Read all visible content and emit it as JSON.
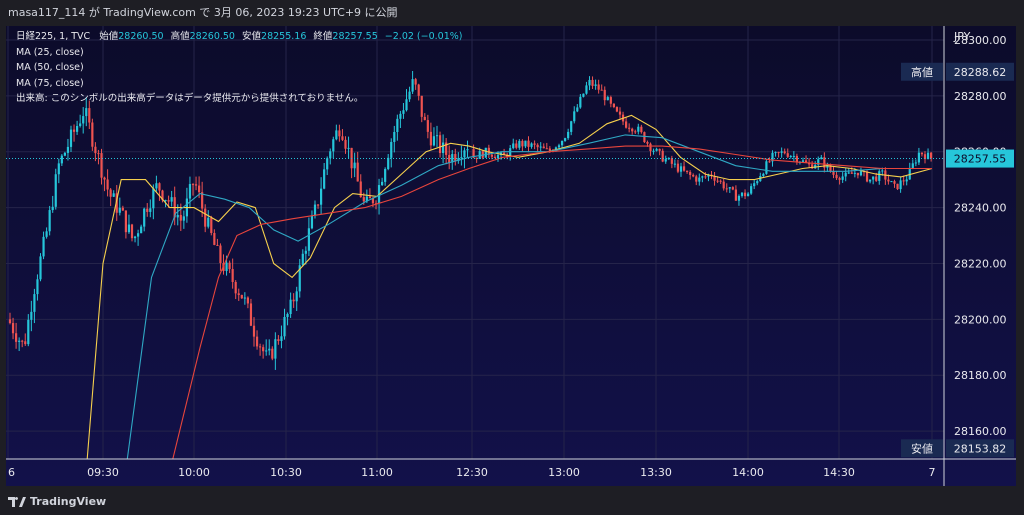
{
  "header": {
    "publish_line": "masa117_114 が TradingView.com で 3月 06, 2023 19:23 UTC+9 に公開"
  },
  "legend": {
    "symbol": "日経225, 1, TVC",
    "open_label": "始値",
    "open_value": "28260.50",
    "high_label": "高値",
    "high_value": "28260.50",
    "low_label": "安値",
    "low_value": "28255.16",
    "close_label": "終値",
    "close_value": "28257.55",
    "change": "−2.02 (−0.01%)",
    "ma25": "MA (25, close)",
    "ma50": "MA (50, close)",
    "ma75": "MA (75, close)",
    "volume_note": "出来高: このシンボルの出来高データはデータ提供元から提供されておりません。"
  },
  "price_axis": {
    "currency": "JPY",
    "high_tag_label": "高値",
    "low_tag_label": "安値"
  },
  "footer": {
    "brand": "TradingView"
  },
  "colors": {
    "background": "#0c0b2a",
    "up": "#26c6da",
    "down": "#ef5350",
    "ma25": "#f6d04d",
    "ma50": "#2fa8c4",
    "ma75": "#e8453c",
    "grid": "#25244a",
    "last_price_tag": "#26c6da"
  },
  "chart_data": {
    "type": "candlestick",
    "interval": "1",
    "session_date": "2023-03-06",
    "ylim": [
      28150,
      28305
    ],
    "yticks": [
      28160,
      28180,
      28200,
      28220,
      28240,
      28260,
      28280,
      28300
    ],
    "x_tick_labels": [
      "6",
      "09:30",
      "10:00",
      "10:30",
      "11:00",
      "12:30",
      "13:00",
      "13:30",
      "14:00",
      "14:30",
      "7"
    ],
    "session_high": 28288.62,
    "session_low": 28153.82,
    "last_price": 28257.55,
    "open": 28260.5,
    "high": 28260.5,
    "low": 28255.16,
    "close": 28257.55,
    "price_path": [
      [
        "09:00",
        28200
      ],
      [
        "09:05",
        28190
      ],
      [
        "09:08",
        28210
      ],
      [
        "09:12",
        28230
      ],
      [
        "09:16",
        28255
      ],
      [
        "09:20",
        28265
      ],
      [
        "09:24",
        28275
      ],
      [
        "09:28",
        28260
      ],
      [
        "09:32",
        28245
      ],
      [
        "09:36",
        28238
      ],
      [
        "09:40",
        28228
      ],
      [
        "09:44",
        28240
      ],
      [
        "09:48",
        28248
      ],
      [
        "09:52",
        28242
      ],
      [
        "09:56",
        28235
      ],
      [
        "10:00",
        28250
      ],
      [
        "10:04",
        28235
      ],
      [
        "10:08",
        28222
      ],
      [
        "10:12",
        28215
      ],
      [
        "10:16",
        28208
      ],
      [
        "10:20",
        28195
      ],
      [
        "10:24",
        28185
      ],
      [
        "10:28",
        28195
      ],
      [
        "10:32",
        28205
      ],
      [
        "10:36",
        28225
      ],
      [
        "10:40",
        28240
      ],
      [
        "10:44",
        28260
      ],
      [
        "10:48",
        28270
      ],
      [
        "10:52",
        28255
      ],
      [
        "10:56",
        28240
      ],
      [
        "11:00",
        28245
      ],
      [
        "11:04",
        28262
      ],
      [
        "11:08",
        28275
      ],
      [
        "11:12",
        28285
      ],
      [
        "11:16",
        28268
      ],
      [
        "11:20",
        28262
      ],
      [
        "11:24",
        28258
      ],
      [
        "11:28",
        28262
      ],
      [
        "11:30",
        28263
      ],
      [
        "12:30",
        28258
      ],
      [
        "12:35",
        28260
      ],
      [
        "12:40",
        28258
      ],
      [
        "12:45",
        28263
      ],
      [
        "12:50",
        28262
      ],
      [
        "12:55",
        28260
      ],
      [
        "13:00",
        28265
      ],
      [
        "13:04",
        28275
      ],
      [
        "13:08",
        28285
      ],
      [
        "13:12",
        28282
      ],
      [
        "13:16",
        28275
      ],
      [
        "13:20",
        28270
      ],
      [
        "13:24",
        28268
      ],
      [
        "13:28",
        28262
      ],
      [
        "13:32",
        28258
      ],
      [
        "13:36",
        28255
      ],
      [
        "13:40",
        28252
      ],
      [
        "13:44",
        28250
      ],
      [
        "13:48",
        28252
      ],
      [
        "13:52",
        28248
      ],
      [
        "13:56",
        28244
      ],
      [
        "14:00",
        28245
      ],
      [
        "14:04",
        28252
      ],
      [
        "14:08",
        28258
      ],
      [
        "14:12",
        28260
      ],
      [
        "14:16",
        28258
      ],
      [
        "14:20",
        28255
      ],
      [
        "14:24",
        28257
      ],
      [
        "14:28",
        28252
      ],
      [
        "14:32",
        28251
      ],
      [
        "14:36",
        28253
      ],
      [
        "14:40",
        28250
      ],
      [
        "14:44",
        28252
      ],
      [
        "14:48",
        28247
      ],
      [
        "14:52",
        28251
      ],
      [
        "14:56",
        28260
      ],
      [
        "15:00",
        28257.55
      ]
    ],
    "ma_series": [
      {
        "name": "MA (25, close)",
        "color": "#f6d04d",
        "values": [
          [
            "09:25",
            28150
          ],
          [
            "09:30",
            28220
          ],
          [
            "09:36",
            28250
          ],
          [
            "09:44",
            28250
          ],
          [
            "09:52",
            28240
          ],
          [
            "10:00",
            28240
          ],
          [
            "10:08",
            28235
          ],
          [
            "10:14",
            28242
          ],
          [
            "10:20",
            28240
          ],
          [
            "10:26",
            28220
          ],
          [
            "10:32",
            28215
          ],
          [
            "10:38",
            28222
          ],
          [
            "10:46",
            28240
          ],
          [
            "10:52",
            28245
          ],
          [
            "11:00",
            28244
          ],
          [
            "11:08",
            28252
          ],
          [
            "11:16",
            28260
          ],
          [
            "11:24",
            28263
          ],
          [
            "11:30",
            28262
          ],
          [
            "12:35",
            28260
          ],
          [
            "12:45",
            28258
          ],
          [
            "12:55",
            28260
          ],
          [
            "13:05",
            28263
          ],
          [
            "13:14",
            28270
          ],
          [
            "13:22",
            28273
          ],
          [
            "13:30",
            28268
          ],
          [
            "13:38",
            28258
          ],
          [
            "13:46",
            28252
          ],
          [
            "13:54",
            28250
          ],
          [
            "14:02",
            28250
          ],
          [
            "14:10",
            28252
          ],
          [
            "14:18",
            28254
          ],
          [
            "14:26",
            28255
          ],
          [
            "14:34",
            28254
          ],
          [
            "14:42",
            28252
          ],
          [
            "14:50",
            28251
          ],
          [
            "15:00",
            28254
          ]
        ]
      },
      {
        "name": "MA (50, close)",
        "color": "#2fa8c4",
        "values": [
          [
            "09:38",
            28150
          ],
          [
            "09:46",
            28215
          ],
          [
            "09:54",
            28238
          ],
          [
            "10:02",
            28245
          ],
          [
            "10:10",
            28243
          ],
          [
            "10:18",
            28240
          ],
          [
            "10:26",
            28232
          ],
          [
            "10:34",
            28228
          ],
          [
            "10:44",
            28234
          ],
          [
            "10:56",
            28242
          ],
          [
            "11:08",
            28248
          ],
          [
            "11:20",
            28255
          ],
          [
            "11:30",
            28258
          ],
          [
            "12:40",
            28260
          ],
          [
            "12:55",
            28260
          ],
          [
            "13:08",
            28263
          ],
          [
            "13:20",
            28266
          ],
          [
            "13:32",
            28265
          ],
          [
            "13:44",
            28260
          ],
          [
            "13:56",
            28255
          ],
          [
            "14:08",
            28253
          ],
          [
            "14:20",
            28253
          ],
          [
            "14:32",
            28253
          ],
          [
            "14:44",
            28254
          ],
          [
            "15:00",
            28254
          ]
        ]
      },
      {
        "name": "MA (75, close)",
        "color": "#e8453c",
        "values": [
          [
            "09:53",
            28150
          ],
          [
            "10:02",
            28190
          ],
          [
            "10:08",
            28215
          ],
          [
            "10:14",
            28230
          ],
          [
            "10:22",
            28234
          ],
          [
            "10:32",
            28236
          ],
          [
            "10:44",
            28238
          ],
          [
            "10:56",
            28240
          ],
          [
            "11:08",
            28244
          ],
          [
            "11:20",
            28250
          ],
          [
            "11:30",
            28254
          ],
          [
            "12:40",
            28258
          ],
          [
            "12:55",
            28260
          ],
          [
            "13:08",
            28261
          ],
          [
            "13:20",
            28262
          ],
          [
            "13:32",
            28262
          ],
          [
            "13:44",
            28261
          ],
          [
            "13:56",
            28259
          ],
          [
            "14:08",
            28257
          ],
          [
            "14:20",
            28256
          ],
          [
            "14:32",
            28255
          ],
          [
            "14:44",
            28254
          ],
          [
            "15:00",
            28254
          ]
        ]
      }
    ]
  }
}
